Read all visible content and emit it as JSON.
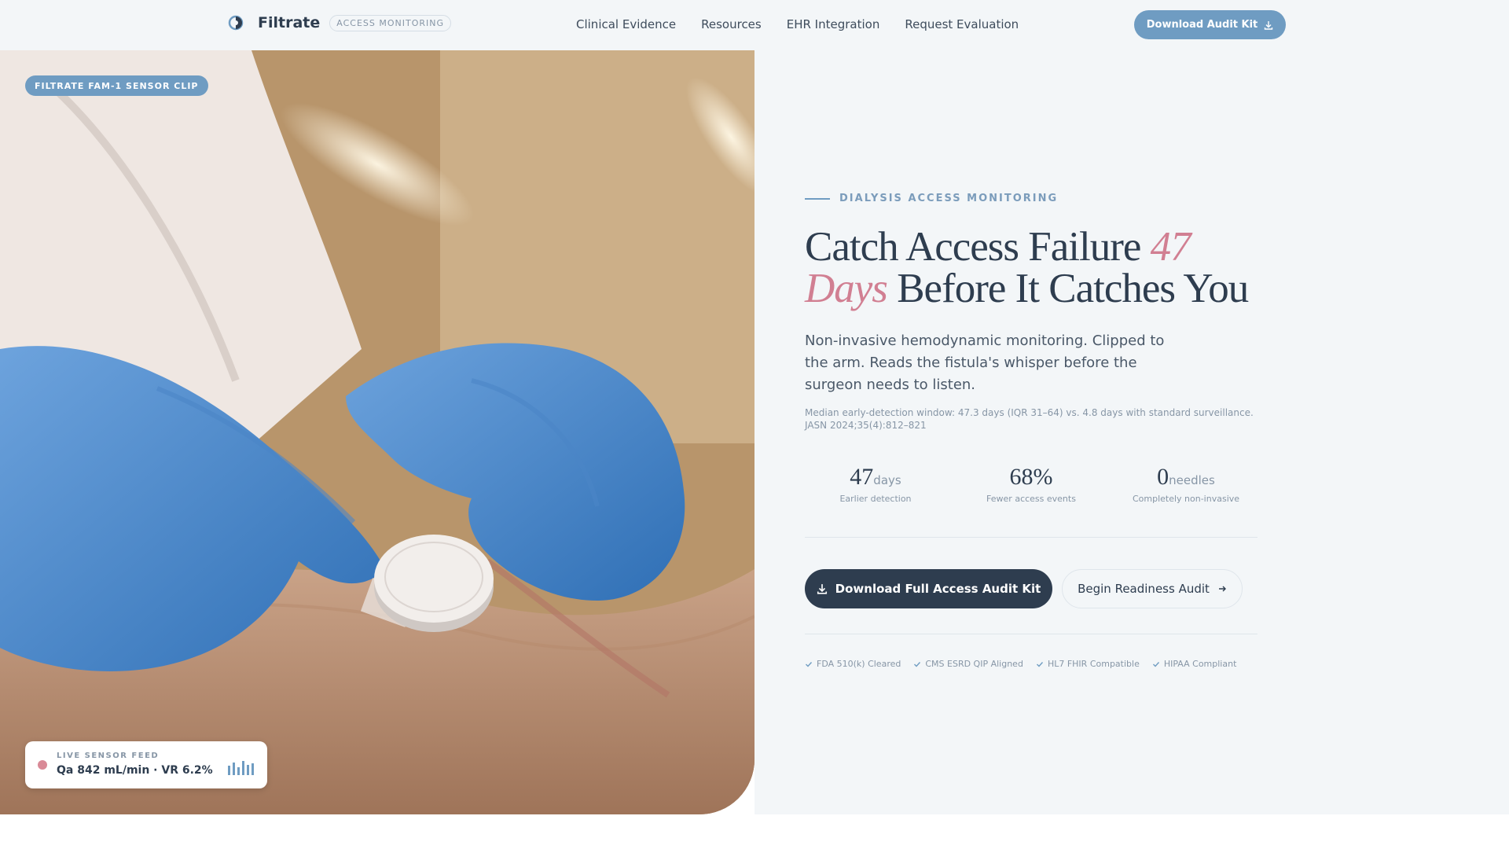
{
  "header": {
    "brand_name": "Filtrate",
    "brand_badge": "ACCESS MONITORING",
    "nav": [
      "Clinical Evidence",
      "Resources",
      "EHR Integration",
      "Request Evaluation"
    ],
    "cta_label": "Download Audit Kit"
  },
  "photo": {
    "badge": "FILTRATE FAM-1 SENSOR CLIP",
    "sensor_feed_label": "LIVE SENSOR FEED",
    "sensor_feed_value": "Qa 842 mL/min · VR 6.2%"
  },
  "hero": {
    "eyebrow": "DIALYSIS ACCESS MONITORING",
    "headline_part1": "Catch Access Failure ",
    "headline_accent": "47 Days",
    "headline_part2": " Before It Catches You",
    "lede": "Non-invasive hemodynamic monitoring. Clipped to the arm. Reads the fistula's whisper before the surgeon needs to listen.",
    "citation": "Median early-detection window: 47.3 days (IQR 31–64) vs. 4.8 days with standard surveillance. JASN 2024;35(4):812–821"
  },
  "stats": [
    {
      "value": "47",
      "unit": "days",
      "label": "Earlier detection"
    },
    {
      "value": "68%",
      "unit": "",
      "label": "Fewer access events"
    },
    {
      "value": "0",
      "unit": "needles",
      "label": "Completely non-invasive"
    }
  ],
  "actions": {
    "primary": "Download Full Access Audit Kit",
    "secondary": "Begin Readiness Audit"
  },
  "compliance": [
    "FDA 510(k) Cleared",
    "CMS ESRD QIP Aligned",
    "HL7 FHIR Compatible",
    "HIPAA Compliant"
  ],
  "colors": {
    "accent_blue": "#6f9cc2",
    "accent_pink": "#d17f92",
    "dark_navy": "#2e3d4f",
    "panel_bg": "#f3f6f8"
  }
}
